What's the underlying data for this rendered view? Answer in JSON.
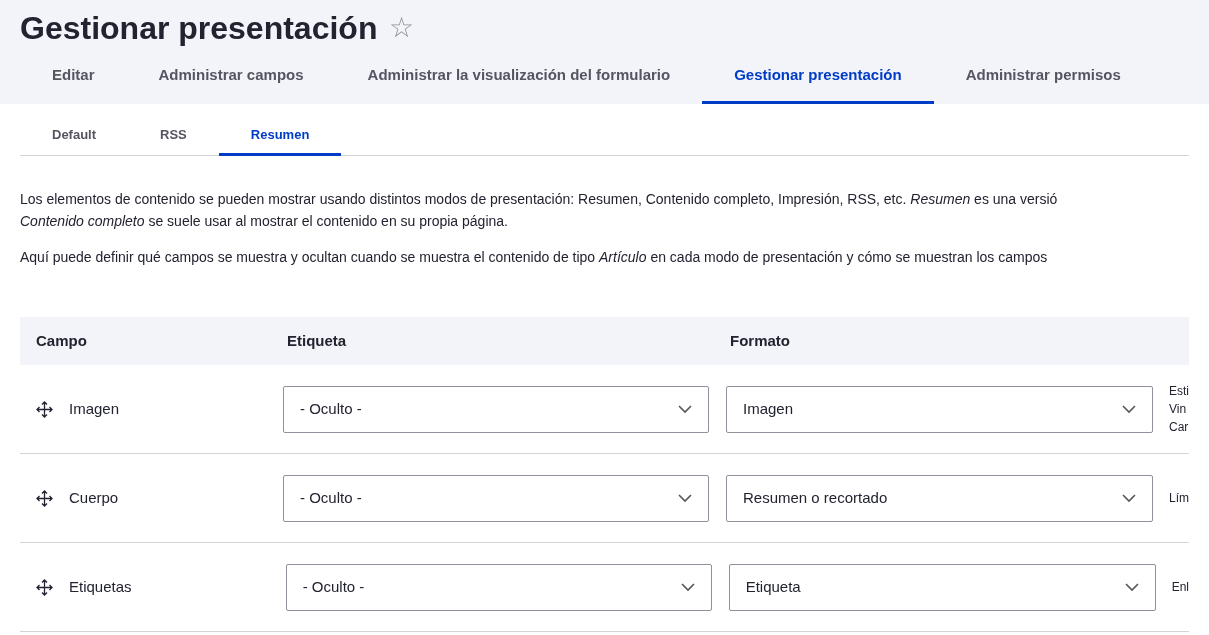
{
  "page_title": "Gestionar presentación",
  "favorite": {
    "icon": "☆",
    "on": false
  },
  "primary_tabs": [
    {
      "label": "Editar",
      "selected": false
    },
    {
      "label": "Administrar campos",
      "selected": false
    },
    {
      "label": "Administrar la visualización del formulario",
      "selected": false
    },
    {
      "label": "Gestionar presentación",
      "selected": true
    },
    {
      "label": "Administrar permisos",
      "selected": false
    }
  ],
  "secondary_tabs": [
    {
      "label": "Default",
      "selected": false
    },
    {
      "label": "RSS",
      "selected": false
    },
    {
      "label": "Resumen",
      "selected": true
    }
  ],
  "description": [
    [
      "Los elementos de contenido se pueden mostrar usando distintos modos de presentación: Resumen, Contenido completo, Impresión, RSS, etc. *Resumen* es una versió",
      "*Contenido completo* se suele usar al mostrar el contenido en su propia página."
    ],
    [
      "Aquí puede definir qué campos se muestra y ocultan cuando se muestra el contenido de tipo *Artículo* en cada modo de presentación y cómo se muestran los campos"
    ]
  ],
  "table": {
    "columns": [
      "Campo",
      "Etiqueta",
      "Formato"
    ],
    "rows": [
      {
        "field": "Imagen",
        "label": "- Oculto -",
        "format": "Imagen",
        "summary": [
          "Esti",
          "Vin",
          "Car"
        ]
      },
      {
        "field": "Cuerpo",
        "label": "- Oculto -",
        "format": "Resumen o recortado",
        "summary": [
          "Lím"
        ]
      },
      {
        "field": "Etiquetas",
        "label": "- Oculto -",
        "format": "Etiqueta",
        "summary": [
          "Enl"
        ]
      }
    ]
  }
}
